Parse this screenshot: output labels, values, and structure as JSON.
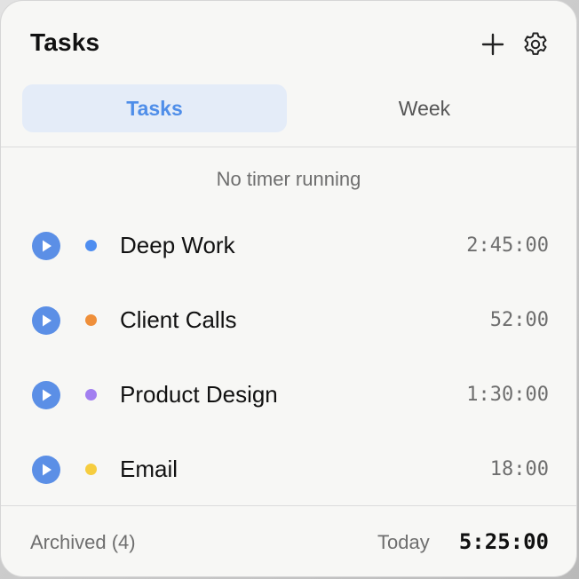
{
  "header": {
    "title": "Tasks",
    "add_icon": "plus-icon",
    "settings_icon": "gear-icon"
  },
  "tabs": [
    {
      "label": "Tasks",
      "active": true
    },
    {
      "label": "Week",
      "active": false
    }
  ],
  "status": "No timer running",
  "tasks": [
    {
      "name": "Deep Work",
      "time": "2:45:00",
      "color": "#4f8ef0"
    },
    {
      "name": "Client Calls",
      "time": "52:00",
      "color": "#ef8f3a"
    },
    {
      "name": "Product Design",
      "time": "1:30:00",
      "color": "#a27ff0"
    },
    {
      "name": "Email",
      "time": "18:00",
      "color": "#f6cd3f"
    }
  ],
  "footer": {
    "archived": "Archived (4)",
    "today_label": "Today",
    "today_total": "5:25:00"
  },
  "colors": {
    "accent": "#4f8ee9",
    "play_button": "#5b8fe6",
    "active_tab_bg": "#e4ecf8"
  }
}
